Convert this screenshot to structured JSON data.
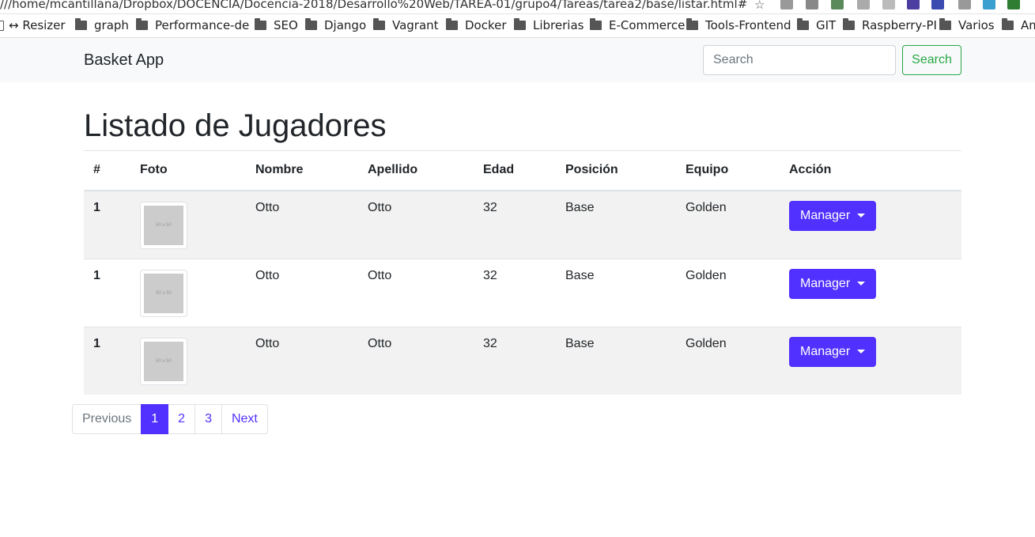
{
  "browser": {
    "url": "///home/mcantillana/Dropbox/DOCENCIA/Docencia-2018/Desarrollo%20Web/TAREA-01/grupo4/Tareas/tarea2/base/listar.html#",
    "bookmarks": [
      "↔ Resizer",
      "graph",
      "Performance-de",
      "SEO",
      "Django",
      "Vagrant",
      "Docker",
      "Librerias",
      "E-Commerce",
      "Tools-Frontend",
      "GIT",
      "Raspberry-PI",
      "Varios",
      "Am"
    ]
  },
  "navbar": {
    "brand": "Basket App",
    "search_placeholder": "Search",
    "search_button": "Search"
  },
  "main": {
    "title": "Listado de Jugadores",
    "columns": [
      "#",
      "Foto",
      "Nombre",
      "Apellido",
      "Edad",
      "Posición",
      "Equipo",
      "Acción"
    ],
    "rows": [
      {
        "num": "1",
        "photo": "50 x 50",
        "nombre": "Otto",
        "apellido": "Otto",
        "edad": "32",
        "posicion": "Base",
        "equipo": "Golden",
        "accion": "Manager"
      },
      {
        "num": "1",
        "photo": "50 x 50",
        "nombre": "Otto",
        "apellido": "Otto",
        "edad": "32",
        "posicion": "Base",
        "equipo": "Golden",
        "accion": "Manager"
      },
      {
        "num": "1",
        "photo": "50 x 50",
        "nombre": "Otto",
        "apellido": "Otto",
        "edad": "32",
        "posicion": "Base",
        "equipo": "Golden",
        "accion": "Manager"
      }
    ]
  },
  "pagination": {
    "previous": "Previous",
    "pages": [
      "1",
      "2",
      "3"
    ],
    "active": "1",
    "next": "Next"
  },
  "colors": {
    "primary": "#5031ff",
    "success": "#28a745",
    "navbar_bg": "#f8f9fa",
    "stripe": "#f2f2f2"
  }
}
